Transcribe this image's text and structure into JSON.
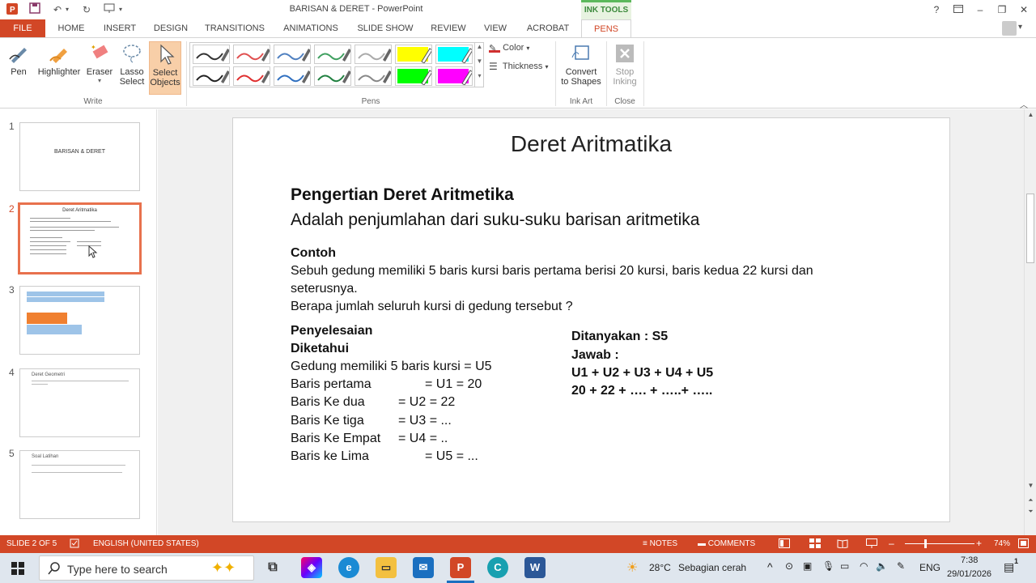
{
  "window": {
    "title": "BARISAN & DERET - PowerPoint",
    "context_tab": "INK TOOLS",
    "help": "?",
    "minimize": "–",
    "restore": "❐",
    "close": "✕"
  },
  "tabs": [
    {
      "label": "FILE"
    },
    {
      "label": "HOME"
    },
    {
      "label": "INSERT"
    },
    {
      "label": "DESIGN"
    },
    {
      "label": "TRANSITIONS"
    },
    {
      "label": "ANIMATIONS"
    },
    {
      "label": "SLIDE SHOW"
    },
    {
      "label": "REVIEW"
    },
    {
      "label": "VIEW"
    },
    {
      "label": "ACROBAT"
    },
    {
      "label": "PENS"
    }
  ],
  "ribbon": {
    "write": {
      "pen": "Pen",
      "highlighter": "Highlighter",
      "eraser": "Eraser",
      "lasso_1": "Lasso",
      "lasso_2": "Select",
      "select_1": "Select",
      "select_2": "Objects",
      "group": "Write"
    },
    "pens": {
      "group": "Pens",
      "color": "Color",
      "thickness": "Thickness",
      "swatches": [
        {
          "color": "#333333"
        },
        {
          "color": "#e05050"
        },
        {
          "color": "#5080c0"
        },
        {
          "color": "#40a060"
        },
        {
          "color": "#aaaaaa"
        },
        {
          "color": "#ffff00"
        },
        {
          "color": "#00ffff"
        },
        {
          "color": "#222222"
        },
        {
          "color": "#e03030"
        },
        {
          "color": "#3070c0"
        },
        {
          "color": "#208040"
        },
        {
          "color": "#888888"
        },
        {
          "color": "#00ff00"
        },
        {
          "color": "#ff00ff"
        }
      ]
    },
    "ink_art": {
      "convert_1": "Convert",
      "convert_2": "to Shapes",
      "group": "Ink Art"
    },
    "close": {
      "stop_1": "Stop",
      "stop_2": "Inking",
      "group": "Close"
    }
  },
  "thumbnails": [
    {
      "num": "1",
      "title": "BARISAN & DERET"
    },
    {
      "num": "2",
      "title": "Deret Aritmatika"
    },
    {
      "num": "3"
    },
    {
      "num": "4",
      "title": "Deret Geometri"
    },
    {
      "num": "5",
      "title": "Soal Latihan"
    }
  ],
  "slide": {
    "title": "Deret Aritmatika",
    "heading": "Pengertian Deret Aritmetika",
    "definition": "Adalah penjumlahan dari suku-suku barisan aritmetika",
    "example_label": "Contoh",
    "example_1": "Sebuh gedung memiliki 5 baris kursi baris pertama berisi 20 kursi, baris kedua 22 kursi dan",
    "example_2": "seterusnya.",
    "question": "Berapa jumlah seluruh kursi di gedung tersebut ?",
    "solution_label": "Penyelesaian",
    "known_label": "Diketahui",
    "known": [
      "Gedung memiliki 5 baris kursi = U5",
      "Baris pertama",
      "= U1 = 20",
      "Baris Ke dua",
      "= U2 = 22",
      "Baris Ke tiga",
      "= U3 = ...",
      "Baris Ke Empat",
      "= U4 = ..",
      "Baris ke Lima",
      "= U5 = ..."
    ],
    "asked": "Ditanyakan : S5",
    "answer_label": "Jawab :",
    "answer_1": "U1 + U2 + U3 + U4 + U5",
    "answer_2": "20 + 22 + …. + …..+ ….."
  },
  "status": {
    "slide": "SLIDE 2 OF 5",
    "language": "ENGLISH (UNITED STATES)",
    "notes": "NOTES",
    "comments": "COMMENTS",
    "zoom_minus": "–",
    "zoom_plus": "+",
    "zoom": "74%"
  },
  "taskbar": {
    "search_placeholder": "Type here to search",
    "weather_temp": "28°C",
    "weather_text": "Sebagian cerah",
    "lang": "ENG",
    "time": "7:38",
    "date": "29/01/2026",
    "notification_count": "1"
  }
}
